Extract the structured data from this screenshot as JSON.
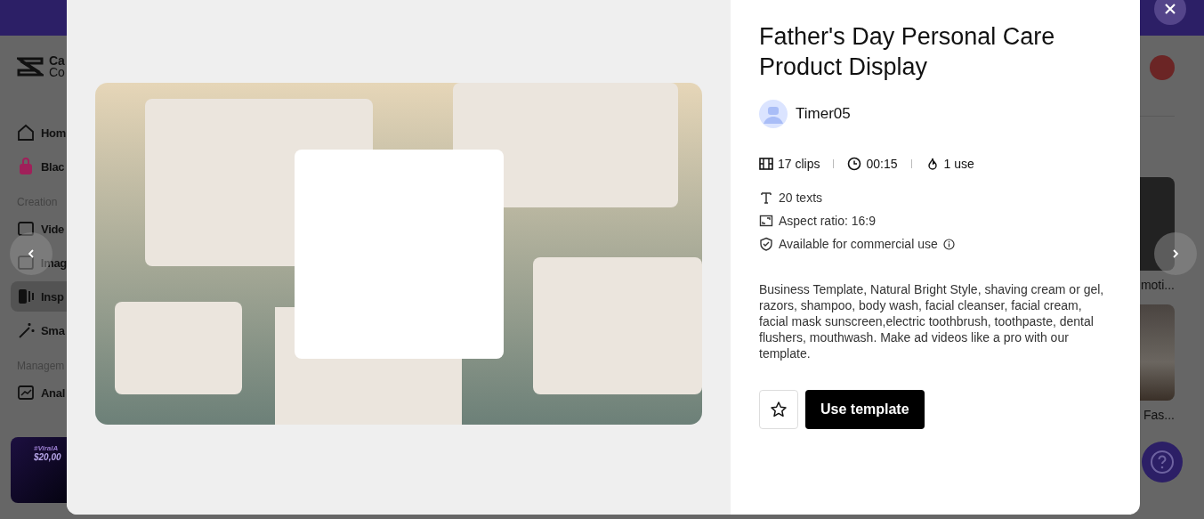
{
  "sidebar": {
    "logo": [
      "Ca",
      "Co"
    ],
    "items": [
      {
        "label": "Hom",
        "kind": "item",
        "selected": false
      },
      {
        "label": "Blac",
        "kind": "item",
        "selected": false
      },
      {
        "label": "Creation",
        "kind": "section"
      },
      {
        "label": "Vide",
        "kind": "item",
        "selected": false
      },
      {
        "label": "Imag",
        "kind": "item",
        "selected": false
      },
      {
        "label": "Insp",
        "kind": "item",
        "selected": true
      },
      {
        "label": "Sma",
        "kind": "item",
        "selected": false
      },
      {
        "label": "Managem",
        "kind": "section"
      },
      {
        "label": "Anal",
        "kind": "item",
        "selected": false
      }
    ],
    "promo": [
      "#ViralA",
      "$20,00"
    ]
  },
  "cards": [
    {
      "caption": "moti..."
    },
    {
      "caption": "Fas..."
    }
  ],
  "modal": {
    "title": "Father's Day Personal Care Product Display",
    "author": "Timer05",
    "stats": [
      "17 clips",
      "00:15",
      "1 use"
    ],
    "details": [
      "20 texts",
      "Aspect ratio: 16:9",
      "Available for commercial use"
    ],
    "description": "Business Template, Natural Bright Style, shaving cream or gel, razors, shampoo, body wash, facial cleanser, facial cream, facial mask sunscreen,electric toothbrush, toothpaste, dental flushers, mouthwash. Make ad videos like a pro with our template.",
    "favorited": false,
    "button": "Use template"
  }
}
